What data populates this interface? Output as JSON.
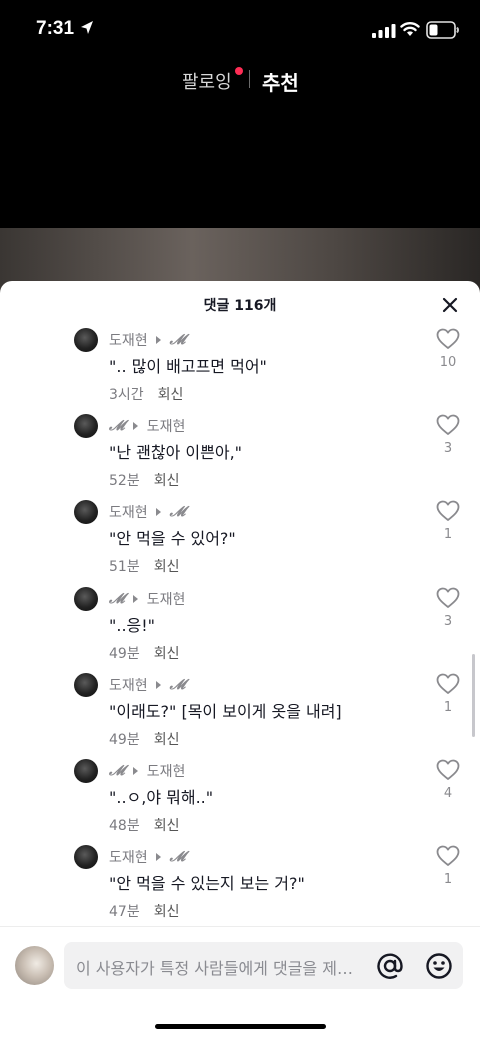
{
  "status_bar": {
    "time": "7:31"
  },
  "top_nav": {
    "following": "팔로잉",
    "recommend": "추천"
  },
  "sheet": {
    "title": "댓글 116개",
    "comments": [
      {
        "from": "도재현",
        "to": "𝓜",
        "text": "\".. 많이 배고프면 먹어\"",
        "time": "3시간",
        "reply": "회신",
        "likes": "10"
      },
      {
        "from": "𝓜",
        "to": "도재현",
        "text": "\"난 괜찮아 이쁜아,\"",
        "time": "52분",
        "reply": "회신",
        "likes": "3"
      },
      {
        "from": "도재현",
        "to": "𝓜",
        "text": "\"안 먹을 수 있어?\"",
        "time": "51분",
        "reply": "회신",
        "likes": "1"
      },
      {
        "from": "𝓜",
        "to": "도재현",
        "text": "\"..응!\"",
        "time": "49분",
        "reply": "회신",
        "likes": "3"
      },
      {
        "from": "도재현",
        "to": "𝓜",
        "text": "\"이래도?\" [목이 보이게 옷을 내려]",
        "time": "49분",
        "reply": "회신",
        "likes": "1"
      },
      {
        "from": "𝓜",
        "to": "도재현",
        "text": "\"..ㅇ,야 뭐해..\"",
        "time": "48분",
        "reply": "회신",
        "likes": "4"
      },
      {
        "from": "도재현",
        "to": "𝓜",
        "text": "\"안 먹을 수 있는지 보는 거?\"",
        "time": "47분",
        "reply": "회신",
        "likes": "1"
      }
    ]
  },
  "input": {
    "placeholder": "이 사용자가 특정 사람들에게 댓글을 제…"
  },
  "icons": {
    "location": "location-arrow-icon",
    "signal": "signal-icon",
    "wifi": "wifi-icon",
    "battery": "battery-icon",
    "close": "close-icon",
    "heart": "heart-outline-icon",
    "at": "at-sign-icon",
    "emoji": "emoji-icon"
  },
  "colors": {
    "accent_dot": "#ff2d55",
    "text_primary": "#161823",
    "text_secondary": "#7b7b80"
  }
}
